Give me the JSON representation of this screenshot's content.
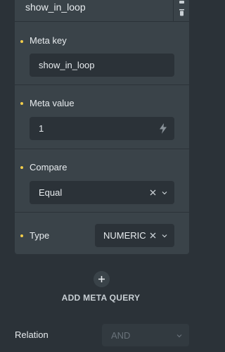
{
  "query_item": {
    "title": "show_in_loop",
    "meta_key": {
      "label": "Meta key",
      "value": "show_in_loop"
    },
    "meta_value": {
      "label": "Meta value",
      "value": "1",
      "dynamic_icon": "lightning-icon"
    },
    "compare": {
      "label": "Compare",
      "value": "Equal"
    },
    "type": {
      "label": "Type",
      "value": "NUMERIC"
    }
  },
  "add_meta_query": {
    "label": "ADD META QUERY",
    "icon": "plus-icon"
  },
  "relation": {
    "label": "Relation",
    "value": "AND"
  },
  "colors": {
    "background": "#2b3238",
    "panel": "#3a4349",
    "accent_dot": "#f2cd4a",
    "text": "#e8ecef",
    "muted": "#69727a"
  }
}
